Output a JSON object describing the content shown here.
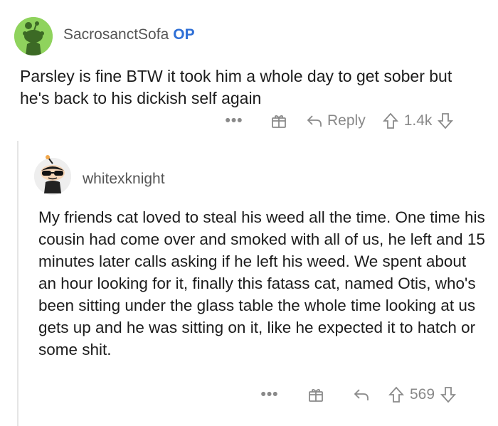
{
  "comment1": {
    "username": "SacrosanctSofa",
    "op_badge": "OP",
    "body": "Parsley is fine BTW it took him a whole day to get sober but he's back to his dickish self again",
    "reply_label": "Reply",
    "score": "1.4k"
  },
  "comment2": {
    "username": "whitexknight",
    "body": "My friends cat loved to steal his weed all the time. One time his cousin had come over and smoked with all of us, he left and 15 minutes later calls asking if he left his weed. We spent about an hour looking for it, finally this fatass cat, named Otis, who's been sitting under the glass table the whole time looking at us gets up and he was sitting on it, like he expected it to hatch or some shit.",
    "score": "569"
  },
  "icons": [
    "more-options-icon",
    "gift-award-icon",
    "reply-arrow-icon",
    "upvote-icon",
    "downvote-icon"
  ],
  "colors": {
    "op_badge": "#2e6fd6",
    "avatar1_bg": "#8fd35d",
    "muted": "#888888"
  }
}
